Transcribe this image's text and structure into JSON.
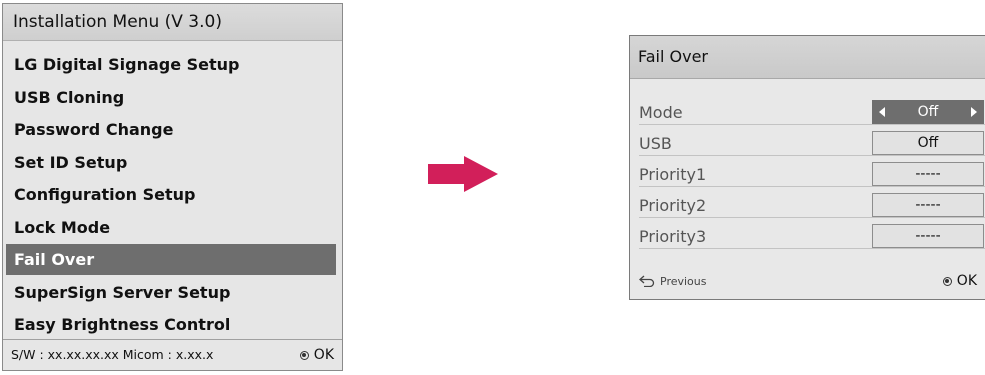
{
  "installation_menu": {
    "title": "Installation Menu (V 3.0)",
    "items": [
      {
        "label": "LG Digital Signage Setup"
      },
      {
        "label": "USB Cloning"
      },
      {
        "label": "Password Change"
      },
      {
        "label": "Set ID Setup"
      },
      {
        "label": "Configuration Setup"
      },
      {
        "label": "Lock Mode"
      },
      {
        "label": "Fail Over",
        "selected": true
      },
      {
        "label": "SuperSign Server Setup"
      },
      {
        "label": "Easy Brightness Control"
      }
    ],
    "footer": {
      "version_text": "S/W : xx.xx.xx.xx Micom : x.xx.x",
      "ok_label": "OK"
    }
  },
  "arrow": {
    "color": "#d21f5a",
    "icon": "right-arrow-icon"
  },
  "fail_over_dialog": {
    "title": "Fail Over",
    "rows": [
      {
        "label": "Mode",
        "value": "Off"
      },
      {
        "label": "USB",
        "value": "Off"
      },
      {
        "label": "Priority1",
        "value": "-----"
      },
      {
        "label": "Priority2",
        "value": "-----"
      },
      {
        "label": "Priority3",
        "value": "-----"
      }
    ],
    "footer": {
      "previous_label": "Previous",
      "ok_label": "OK"
    }
  },
  "colors": {
    "selection": "#6e6e6e",
    "panel_background": "#e6e6e6",
    "arrow": "#d21f5a"
  }
}
